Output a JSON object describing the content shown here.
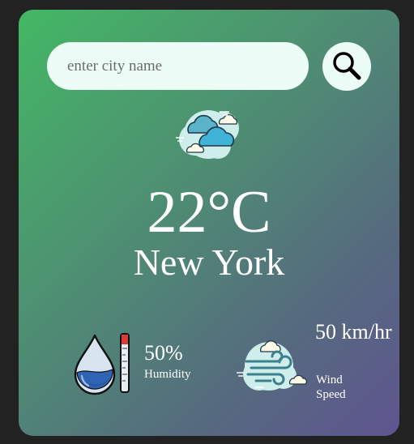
{
  "search": {
    "placeholder": "enter city name",
    "value": ""
  },
  "weather": {
    "condition_icon": "partly-cloudy-icon",
    "temperature": "22°C",
    "city": "New York"
  },
  "details": {
    "humidity": {
      "value": "50%",
      "label": "Humidity",
      "icon": "humidity-icon"
    },
    "wind": {
      "value": "50 km/hr",
      "label": "Wind Speed",
      "icon": "wind-icon"
    }
  },
  "colors": {
    "page_background": "#222222",
    "gradient_start": "#43b864",
    "gradient_end": "#5f5590",
    "search_background": "#ecfdf7",
    "text": "#ffffff"
  }
}
